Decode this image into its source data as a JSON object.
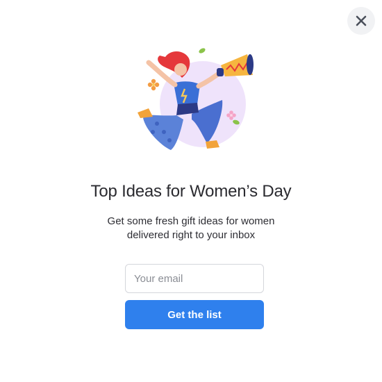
{
  "close_icon": "close-icon",
  "illustration_icon": "woman-with-megaphone-illustration",
  "title": "Top Ideas for Women’s Day",
  "subtitle_lines": [
    "Get some fresh gift ideas for women",
    "delivered right to your inbox"
  ],
  "email": {
    "value": "",
    "placeholder": "Your email"
  },
  "submit_label": "Get the list",
  "colors": {
    "accent": "#2f80ed",
    "close_bg": "#f1f2f4",
    "title": "#2b2b30",
    "illustration_bg": "#f0e6fb"
  }
}
